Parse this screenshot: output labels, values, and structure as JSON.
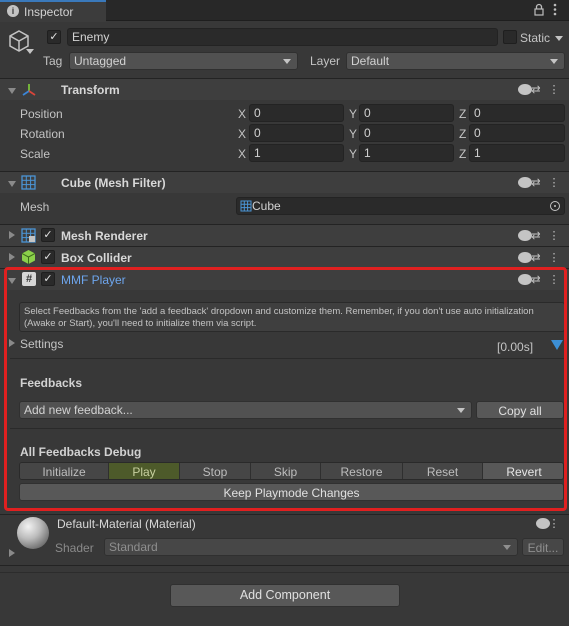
{
  "window": {
    "tab_title": "Inspector",
    "tab_icon": "info-icon",
    "lock_icon": "lock-icon",
    "menu_icon": "kebab-menu-icon"
  },
  "gameobject": {
    "icon": "cube-icon",
    "active": true,
    "name": "Enemy",
    "static_label": "Static",
    "static_checked": false,
    "tag_label": "Tag",
    "tag_value": "Untagged",
    "layer_label": "Layer",
    "layer_value": "Default"
  },
  "transform": {
    "title": "Transform",
    "icon": "transform-axes-icon",
    "rows": [
      {
        "label": "Position",
        "x": "0",
        "y": "0",
        "z": "0"
      },
      {
        "label": "Rotation",
        "x": "0",
        "y": "0",
        "z": "0"
      },
      {
        "label": "Scale",
        "x": "1",
        "y": "1",
        "z": "1"
      }
    ],
    "axis_x": "X",
    "axis_y": "Y",
    "axis_z": "Z"
  },
  "mesh_filter": {
    "title": "Cube (Mesh Filter)",
    "icon": "mesh-grid-icon",
    "mesh_label": "Mesh",
    "mesh_value": "Cube"
  },
  "mesh_renderer": {
    "title": "Mesh Renderer",
    "icon": "mesh-renderer-icon",
    "enabled": true
  },
  "box_collider": {
    "title": "Box Collider",
    "icon": "box-collider-icon",
    "enabled": true
  },
  "mmf_player": {
    "title": "MMF Player",
    "icon": "script-hash-icon",
    "enabled": true,
    "help_text": "Select Feedbacks from the 'add a feedback' dropdown and customize them. Remember, if you don't use auto initialization (Awake or Start), you'll need to initialize them via script.",
    "settings_label": "Settings",
    "duration": "[0.00s]",
    "feedbacks_heading": "Feedbacks",
    "add_feedback_placeholder": "Add new feedback...",
    "copy_all_label": "Copy all",
    "debug_heading": "All Feedbacks Debug",
    "debug_buttons": [
      "Initialize",
      "Play",
      "Stop",
      "Skip",
      "Restore",
      "Reset",
      "Revert"
    ],
    "keep_changes_label": "Keep Playmode Changes",
    "highlight_color": "#e02020"
  },
  "material": {
    "title": "Default-Material (Material)",
    "shader_label": "Shader",
    "shader_value": "Standard",
    "edit_label": "Edit..."
  },
  "add_component_label": "Add Component"
}
